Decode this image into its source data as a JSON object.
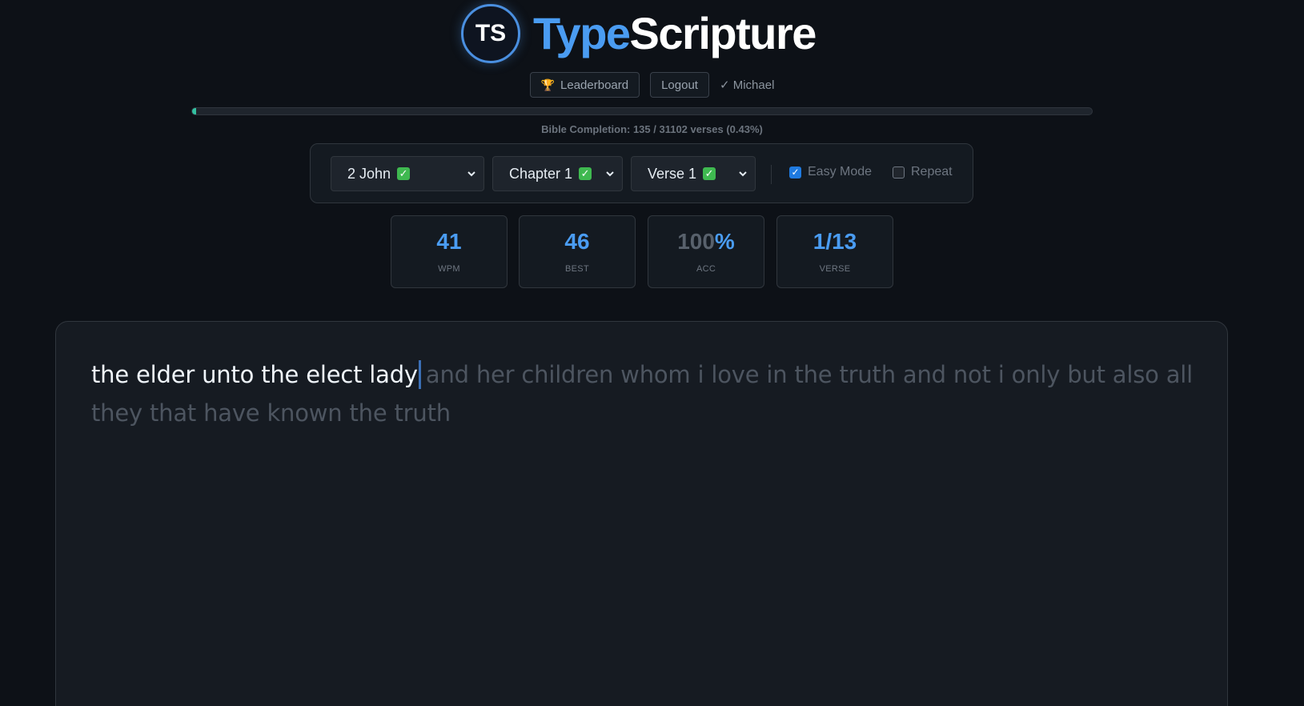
{
  "header": {
    "logo_initials": "TS",
    "title_part1": "Type",
    "title_part2": "Scripture"
  },
  "nav": {
    "leaderboard_icon": "trophy-icon",
    "leaderboard_label": "Leaderboard",
    "logout_label": "Logout",
    "user_label": "✓ Michael"
  },
  "progress": {
    "fraction": 0.0043,
    "text": "Bible Completion: 135 / 31102 verses (0.43%)",
    "fill_color": "#33c1a1"
  },
  "selectors": {
    "book": "2 John",
    "chapter": "Chapter 1",
    "verse": "Verse 1",
    "check_glyph": "✓",
    "easy_mode_label": "Easy Mode",
    "easy_mode_checked": true,
    "repeat_label": "Repeat",
    "repeat_checked": false
  },
  "stats": [
    {
      "value": "41",
      "label": "WPM"
    },
    {
      "value": "46",
      "label": "BEST"
    },
    {
      "value_main": "100",
      "value_suffix": "%",
      "label": "ACC"
    },
    {
      "value": "1/13",
      "label": "VERSE"
    }
  ],
  "typing": {
    "typed": "the elder unto the elect lady",
    "remaining": "and her children whom i love in the truth and not i only but also all they that have known the truth"
  },
  "colors": {
    "accent": "#4a9cf2",
    "background": "#0d1117",
    "check_green": "#3fb950"
  }
}
